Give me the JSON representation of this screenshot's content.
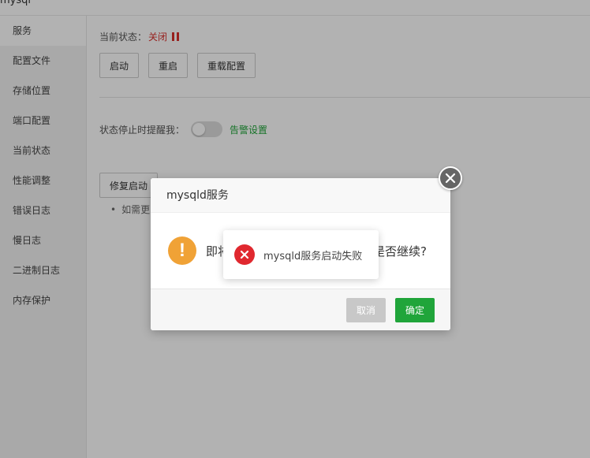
{
  "window": {
    "title": "mysql"
  },
  "sidebar": {
    "items": [
      {
        "label": "服务"
      },
      {
        "label": "配置文件"
      },
      {
        "label": "存储位置"
      },
      {
        "label": "端口配置"
      },
      {
        "label": "当前状态"
      },
      {
        "label": "性能调整"
      },
      {
        "label": "错误日志"
      },
      {
        "label": "慢日志"
      },
      {
        "label": "二进制日志"
      },
      {
        "label": "内存保护"
      }
    ]
  },
  "main": {
    "status_label": "当前状态：",
    "status_value": "关闭",
    "buttons": {
      "start": "启动",
      "restart": "重启",
      "reload": "重载配置"
    },
    "alert_label": "状态停止时提醒我：",
    "alert_toggle_on": false,
    "alert_link": "告警设置",
    "repair_button": "修复启动",
    "tip_text": "如需更"
  },
  "dialog": {
    "title": "mysqld服务",
    "message_left": "即将",
    "message_right": "是否继续?",
    "cancel_label": "取消",
    "confirm_label": "确定"
  },
  "toast": {
    "message": "mysqld服务启动失败"
  },
  "colors": {
    "accent_green": "#20a53a",
    "status_red": "#d9302c",
    "warning_orange": "#f0a236",
    "error_red": "#e0282f"
  },
  "icons": {
    "status": "pause-icon",
    "warning": "exclamation-icon",
    "error": "x-circle-icon",
    "close": "close-icon"
  }
}
